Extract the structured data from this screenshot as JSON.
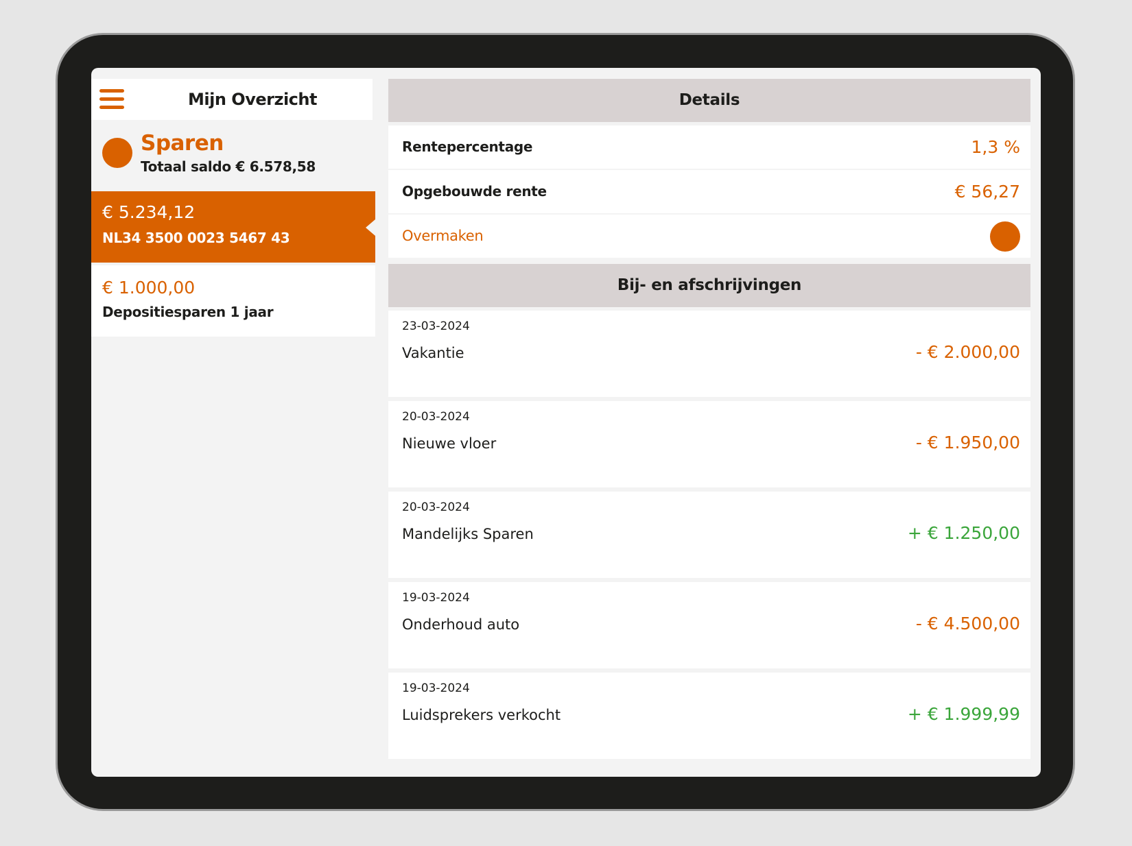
{
  "colors": {
    "accent": "#d96100",
    "positive": "#3aa53a",
    "section_header_bg": "#d8d2d2",
    "device_frame": "#1d1d1b"
  },
  "left": {
    "title": "Mijn Overzicht",
    "menu_icon": "hamburger-menu-icon",
    "summary": {
      "title": "Sparen",
      "balance": "Totaal saldo € 6.578,58"
    },
    "accounts": [
      {
        "amount": "€ 5.234,12",
        "subtitle": "NL34 3500 0023 5467 43",
        "selected": true
      },
      {
        "amount": "€ 1.000,00",
        "subtitle": "Depositiesparen 1 jaar",
        "selected": false
      }
    ]
  },
  "details": {
    "header": "Details",
    "rows": [
      {
        "label": "Rentepercentage",
        "value": "1,3 %"
      },
      {
        "label": "Opgebouwde rente",
        "value": "€ 56,27"
      }
    ],
    "action_label": "Overmaken"
  },
  "transactions": {
    "header": "Bij- en afschrijvingen",
    "items": [
      {
        "date": "23-03-2024",
        "description": "Vakantie",
        "amount": "- € 2.000,00",
        "type": "debit"
      },
      {
        "date": "20-03-2024",
        "description": "Nieuwe vloer",
        "amount": "- € 1.950,00",
        "type": "debit"
      },
      {
        "date": "20-03-2024",
        "description": "Mandelijks Sparen",
        "amount": "+ € 1.250,00",
        "type": "credit"
      },
      {
        "date": "19-03-2024",
        "description": "Onderhoud auto",
        "amount": "- € 4.500,00",
        "type": "debit"
      },
      {
        "date": "19-03-2024",
        "description": "Luidsprekers verkocht",
        "amount": "+ € 1.999,99",
        "type": "credit"
      }
    ]
  }
}
